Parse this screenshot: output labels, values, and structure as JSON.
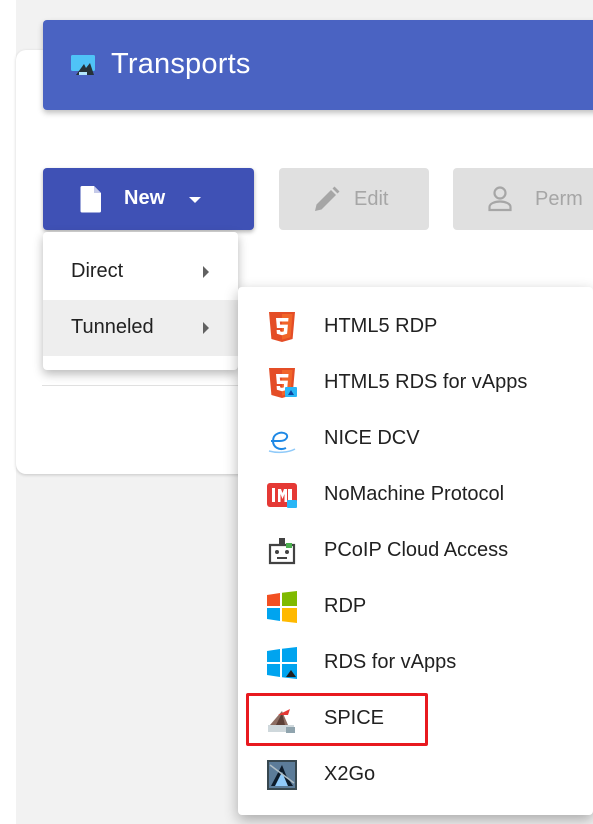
{
  "header": {
    "title": "Transports",
    "icon": "transports-icon"
  },
  "toolbar": {
    "new_label": "New",
    "edit_label": "Edit",
    "permissions_label": "Perm"
  },
  "menu": {
    "items": [
      {
        "label": "Direct",
        "icon": "chevron-right-icon"
      },
      {
        "label": "Tunneled",
        "icon": "chevron-right-icon",
        "highlighted": true
      }
    ]
  },
  "submenu": {
    "items": [
      {
        "label": "HTML5 RDP",
        "icon": "html5-icon"
      },
      {
        "label": "HTML5 RDS for vApps",
        "icon": "html5-vapps-icon"
      },
      {
        "label": "NICE DCV",
        "icon": "nice-dcv-icon"
      },
      {
        "label": "NoMachine Protocol",
        "icon": "nomachine-icon"
      },
      {
        "label": "PCoIP Cloud Access",
        "icon": "pcoip-icon"
      },
      {
        "label": "RDP",
        "icon": "windows-icon"
      },
      {
        "label": "RDS for vApps",
        "icon": "windows-vapps-icon"
      },
      {
        "label": "SPICE",
        "icon": "spice-icon",
        "highlighted": true
      },
      {
        "label": "X2Go",
        "icon": "x2go-icon"
      }
    ]
  },
  "colors": {
    "header": "#4a63c2",
    "primary_button": "#3f51b5",
    "disabled_button": "#e0e0e0",
    "highlight_box": "#e8191f"
  }
}
